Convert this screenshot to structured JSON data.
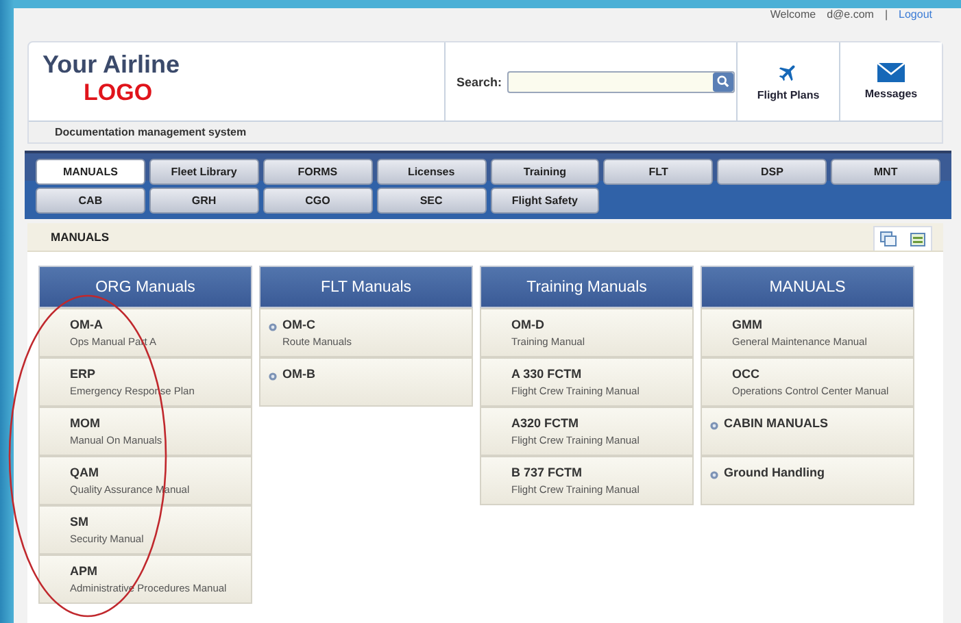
{
  "top_bar": {
    "welcome": "Welcome",
    "user": "d@e.com",
    "separator": "|",
    "logout": "Logout"
  },
  "header": {
    "logo_line1": "Your Airline",
    "logo_line2": "LOGO",
    "subtitle": "Documentation management system",
    "search_label": "Search:",
    "actions": [
      {
        "kind": "plane",
        "label": "Flight Plans"
      },
      {
        "kind": "mail",
        "label": "Messages"
      }
    ]
  },
  "tabs": [
    {
      "label": "MANUALS",
      "selected": true
    },
    {
      "label": "Fleet Library",
      "selected": false
    },
    {
      "label": "FORMS",
      "selected": false
    },
    {
      "label": "Licenses",
      "selected": false
    },
    {
      "label": "Training",
      "selected": false
    },
    {
      "label": "FLT",
      "selected": false
    },
    {
      "label": "DSP",
      "selected": false
    },
    {
      "label": "MNT",
      "selected": false
    },
    {
      "label": "CAB",
      "selected": false
    },
    {
      "label": "GRH",
      "selected": false
    },
    {
      "label": "CGO",
      "selected": false
    },
    {
      "label": "SEC",
      "selected": false
    },
    {
      "label": "Flight Safety",
      "selected": false
    }
  ],
  "section": {
    "title": "MANUALS"
  },
  "columns": [
    {
      "title": "ORG Manuals",
      "items": [
        {
          "code": "OM-A",
          "name": "Ops Manual Part A",
          "expandable": false
        },
        {
          "code": "ERP",
          "name": "Emergency Response Plan",
          "expandable": false
        },
        {
          "code": "MOM",
          "name": "Manual On Manuals",
          "expandable": false
        },
        {
          "code": "QAM",
          "name": "Quality Assurance Manual",
          "expandable": false
        },
        {
          "code": "SM",
          "name": "Security Manual",
          "expandable": false
        },
        {
          "code": "APM",
          "name": "Administrative Procedures Manual",
          "expandable": false
        }
      ]
    },
    {
      "title": "FLT Manuals",
      "items": [
        {
          "code": "OM-C",
          "name": "Route Manuals",
          "expandable": true
        },
        {
          "code": "OM-B",
          "expandable": true
        }
      ]
    },
    {
      "title": "Training Manuals",
      "items": [
        {
          "code": "OM-D",
          "name": "Training Manual",
          "expandable": false
        },
        {
          "code": "A 330 FCTM",
          "name": "Flight Crew Training Manual",
          "expandable": false
        },
        {
          "code": "A320 FCTM",
          "name": "Flight Crew Training Manual",
          "expandable": false
        },
        {
          "code": "B 737 FCTM",
          "name": "Flight Crew Training Manual",
          "expandable": false
        }
      ]
    },
    {
      "title": "MANUALS",
      "items": [
        {
          "code": "GMM",
          "name": "General Maintenance Manual",
          "expandable": false
        },
        {
          "code": "OCC",
          "name": "Operations Control Center Manual",
          "expandable": false
        },
        {
          "code": "CABIN MANUALS",
          "expandable": true
        },
        {
          "code": "Ground Handling",
          "expandable": true
        }
      ]
    }
  ]
}
